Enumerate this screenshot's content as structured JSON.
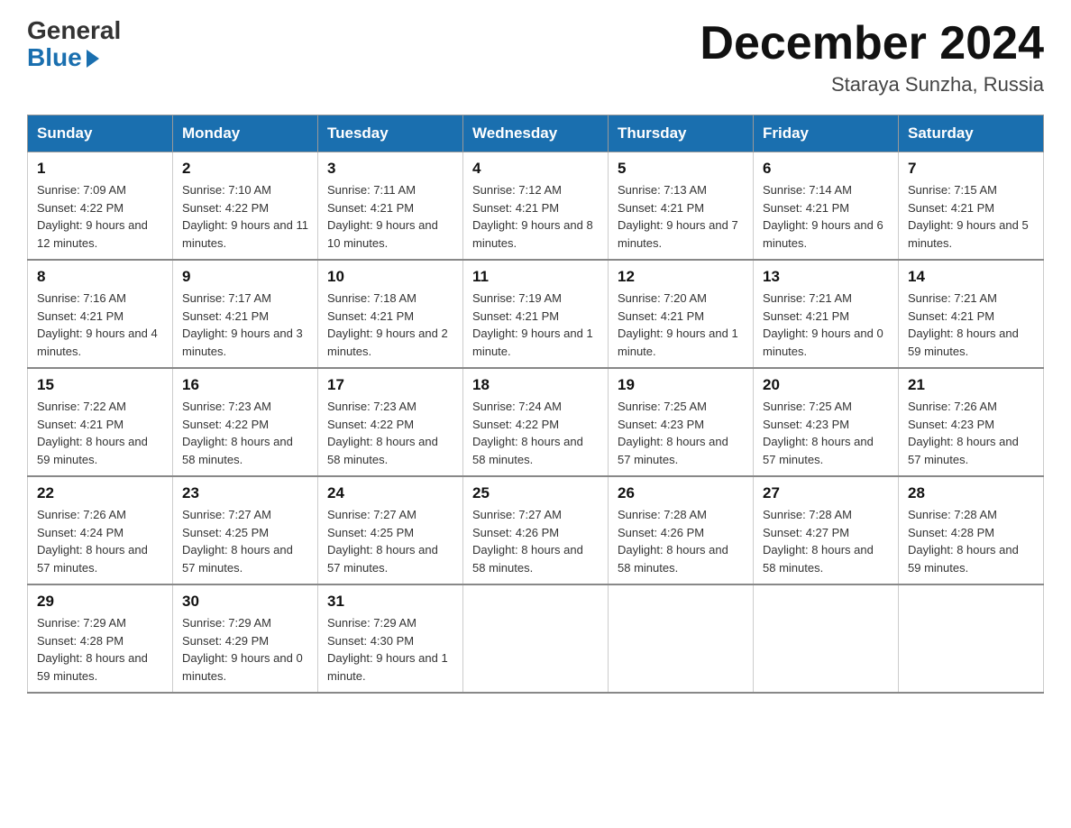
{
  "header": {
    "logo_general": "General",
    "logo_blue": "Blue",
    "month_year": "December 2024",
    "location": "Staraya Sunzha, Russia"
  },
  "days_of_week": [
    "Sunday",
    "Monday",
    "Tuesday",
    "Wednesday",
    "Thursday",
    "Friday",
    "Saturday"
  ],
  "weeks": [
    [
      {
        "day": "1",
        "sunrise": "7:09 AM",
        "sunset": "4:22 PM",
        "daylight": "9 hours and 12 minutes."
      },
      {
        "day": "2",
        "sunrise": "7:10 AM",
        "sunset": "4:22 PM",
        "daylight": "9 hours and 11 minutes."
      },
      {
        "day": "3",
        "sunrise": "7:11 AM",
        "sunset": "4:21 PM",
        "daylight": "9 hours and 10 minutes."
      },
      {
        "day": "4",
        "sunrise": "7:12 AM",
        "sunset": "4:21 PM",
        "daylight": "9 hours and 8 minutes."
      },
      {
        "day": "5",
        "sunrise": "7:13 AM",
        "sunset": "4:21 PM",
        "daylight": "9 hours and 7 minutes."
      },
      {
        "day": "6",
        "sunrise": "7:14 AM",
        "sunset": "4:21 PM",
        "daylight": "9 hours and 6 minutes."
      },
      {
        "day": "7",
        "sunrise": "7:15 AM",
        "sunset": "4:21 PM",
        "daylight": "9 hours and 5 minutes."
      }
    ],
    [
      {
        "day": "8",
        "sunrise": "7:16 AM",
        "sunset": "4:21 PM",
        "daylight": "9 hours and 4 minutes."
      },
      {
        "day": "9",
        "sunrise": "7:17 AM",
        "sunset": "4:21 PM",
        "daylight": "9 hours and 3 minutes."
      },
      {
        "day": "10",
        "sunrise": "7:18 AM",
        "sunset": "4:21 PM",
        "daylight": "9 hours and 2 minutes."
      },
      {
        "day": "11",
        "sunrise": "7:19 AM",
        "sunset": "4:21 PM",
        "daylight": "9 hours and 1 minute."
      },
      {
        "day": "12",
        "sunrise": "7:20 AM",
        "sunset": "4:21 PM",
        "daylight": "9 hours and 1 minute."
      },
      {
        "day": "13",
        "sunrise": "7:21 AM",
        "sunset": "4:21 PM",
        "daylight": "9 hours and 0 minutes."
      },
      {
        "day": "14",
        "sunrise": "7:21 AM",
        "sunset": "4:21 PM",
        "daylight": "8 hours and 59 minutes."
      }
    ],
    [
      {
        "day": "15",
        "sunrise": "7:22 AM",
        "sunset": "4:21 PM",
        "daylight": "8 hours and 59 minutes."
      },
      {
        "day": "16",
        "sunrise": "7:23 AM",
        "sunset": "4:22 PM",
        "daylight": "8 hours and 58 minutes."
      },
      {
        "day": "17",
        "sunrise": "7:23 AM",
        "sunset": "4:22 PM",
        "daylight": "8 hours and 58 minutes."
      },
      {
        "day": "18",
        "sunrise": "7:24 AM",
        "sunset": "4:22 PM",
        "daylight": "8 hours and 58 minutes."
      },
      {
        "day": "19",
        "sunrise": "7:25 AM",
        "sunset": "4:23 PM",
        "daylight": "8 hours and 57 minutes."
      },
      {
        "day": "20",
        "sunrise": "7:25 AM",
        "sunset": "4:23 PM",
        "daylight": "8 hours and 57 minutes."
      },
      {
        "day": "21",
        "sunrise": "7:26 AM",
        "sunset": "4:23 PM",
        "daylight": "8 hours and 57 minutes."
      }
    ],
    [
      {
        "day": "22",
        "sunrise": "7:26 AM",
        "sunset": "4:24 PM",
        "daylight": "8 hours and 57 minutes."
      },
      {
        "day": "23",
        "sunrise": "7:27 AM",
        "sunset": "4:25 PM",
        "daylight": "8 hours and 57 minutes."
      },
      {
        "day": "24",
        "sunrise": "7:27 AM",
        "sunset": "4:25 PM",
        "daylight": "8 hours and 57 minutes."
      },
      {
        "day": "25",
        "sunrise": "7:27 AM",
        "sunset": "4:26 PM",
        "daylight": "8 hours and 58 minutes."
      },
      {
        "day": "26",
        "sunrise": "7:28 AM",
        "sunset": "4:26 PM",
        "daylight": "8 hours and 58 minutes."
      },
      {
        "day": "27",
        "sunrise": "7:28 AM",
        "sunset": "4:27 PM",
        "daylight": "8 hours and 58 minutes."
      },
      {
        "day": "28",
        "sunrise": "7:28 AM",
        "sunset": "4:28 PM",
        "daylight": "8 hours and 59 minutes."
      }
    ],
    [
      {
        "day": "29",
        "sunrise": "7:29 AM",
        "sunset": "4:28 PM",
        "daylight": "8 hours and 59 minutes."
      },
      {
        "day": "30",
        "sunrise": "7:29 AM",
        "sunset": "4:29 PM",
        "daylight": "9 hours and 0 minutes."
      },
      {
        "day": "31",
        "sunrise": "7:29 AM",
        "sunset": "4:30 PM",
        "daylight": "9 hours and 1 minute."
      },
      null,
      null,
      null,
      null
    ]
  ]
}
